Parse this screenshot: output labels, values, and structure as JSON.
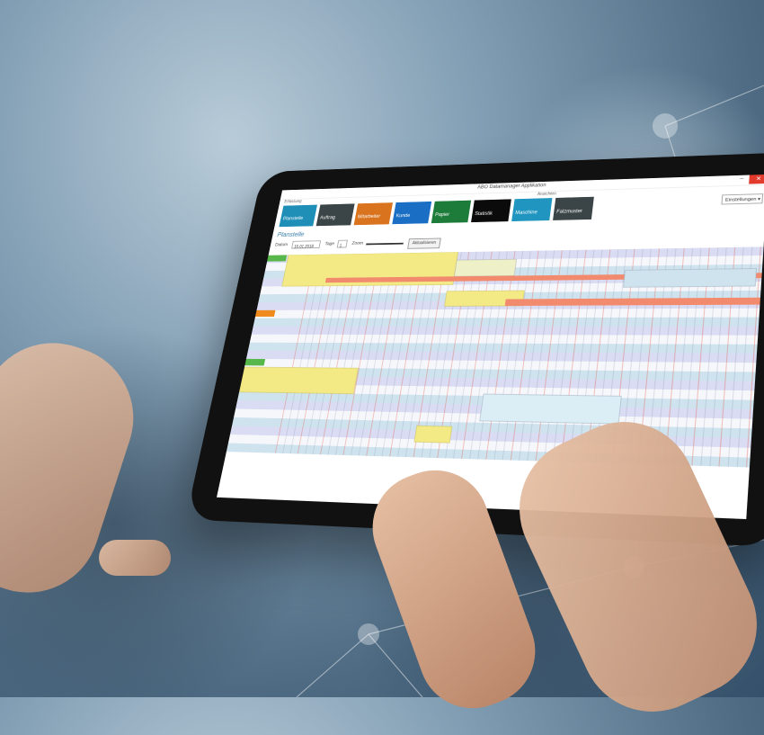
{
  "window": {
    "title": "ABO Datamanager Applikation",
    "minimize_glyph": "–",
    "close_glyph": "✕"
  },
  "toolbar": {
    "group_left": "Erfassung",
    "group_right": "Ansichten",
    "settings_label": "Einstellungen",
    "tiles": [
      {
        "label": "Planstelle",
        "color": "#1f8fb8"
      },
      {
        "label": "Auftrag",
        "color": "#3b4447"
      },
      {
        "label": "Mitarbeiter",
        "color": "#d9731d"
      },
      {
        "label": "Kunde",
        "color": "#1a6fc4"
      },
      {
        "label": "Papier",
        "color": "#1e7c3a"
      },
      {
        "label": "Statistik",
        "color": "#0b0b0b"
      },
      {
        "label": "Maschine",
        "color": "#1f95c0"
      },
      {
        "label": "Falzmuster",
        "color": "#3b4447"
      }
    ]
  },
  "section": {
    "title": "Planstelle"
  },
  "filters": {
    "date_label": "Datum",
    "date_value": "16.01.2018",
    "days_label": "Tage",
    "days_value": "1",
    "zoom_label": "Zoom",
    "refresh_label": "Aktualisieren"
  },
  "gantt": {
    "colors": {
      "yellow": "#f3ea86",
      "red": "#f28a6e",
      "blue": "#cfe3ef",
      "lavender": "#d9dcf2",
      "green": "#58b74a",
      "orange": "#ef8a1c"
    },
    "row_tags": [
      "green",
      "orange",
      "green"
    ]
  }
}
